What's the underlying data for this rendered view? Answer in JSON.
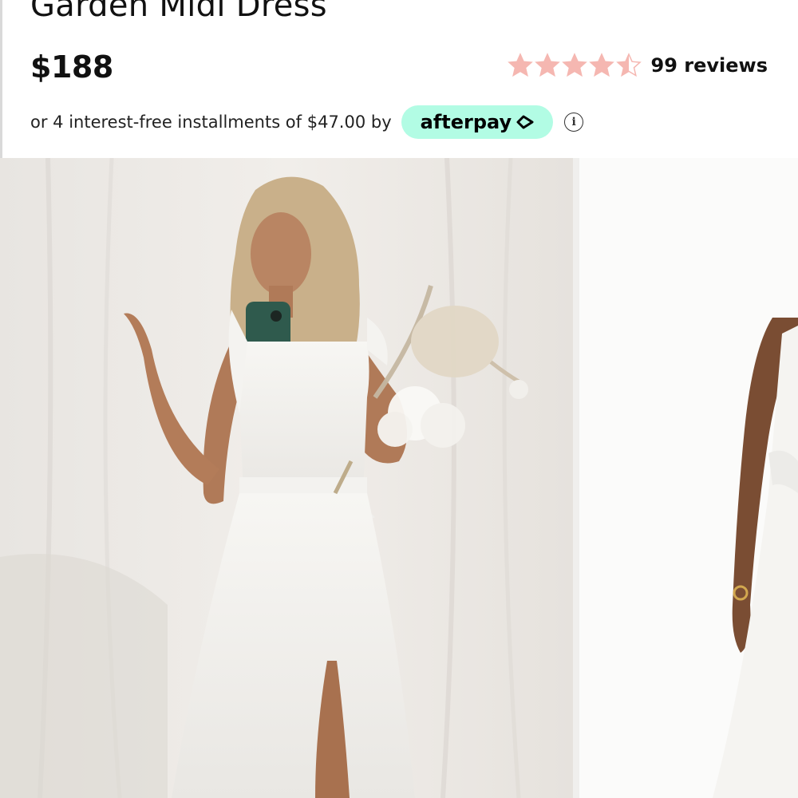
{
  "product": {
    "title": "Garden Midi Dress",
    "price": "$188",
    "rating": 4.5,
    "rating_max": 5,
    "reviews_label": "99 reviews"
  },
  "installments": {
    "text": "or 4 interest-free installments of $47.00 by",
    "provider": "afterpay",
    "info_icon": "info-icon",
    "provider_color": "#b2fce4"
  },
  "colors": {
    "star": "#f5b7b1"
  },
  "gallery": {
    "images": [
      "product-photo-front-model-with-bouquet",
      "product-photo-side-model"
    ]
  }
}
